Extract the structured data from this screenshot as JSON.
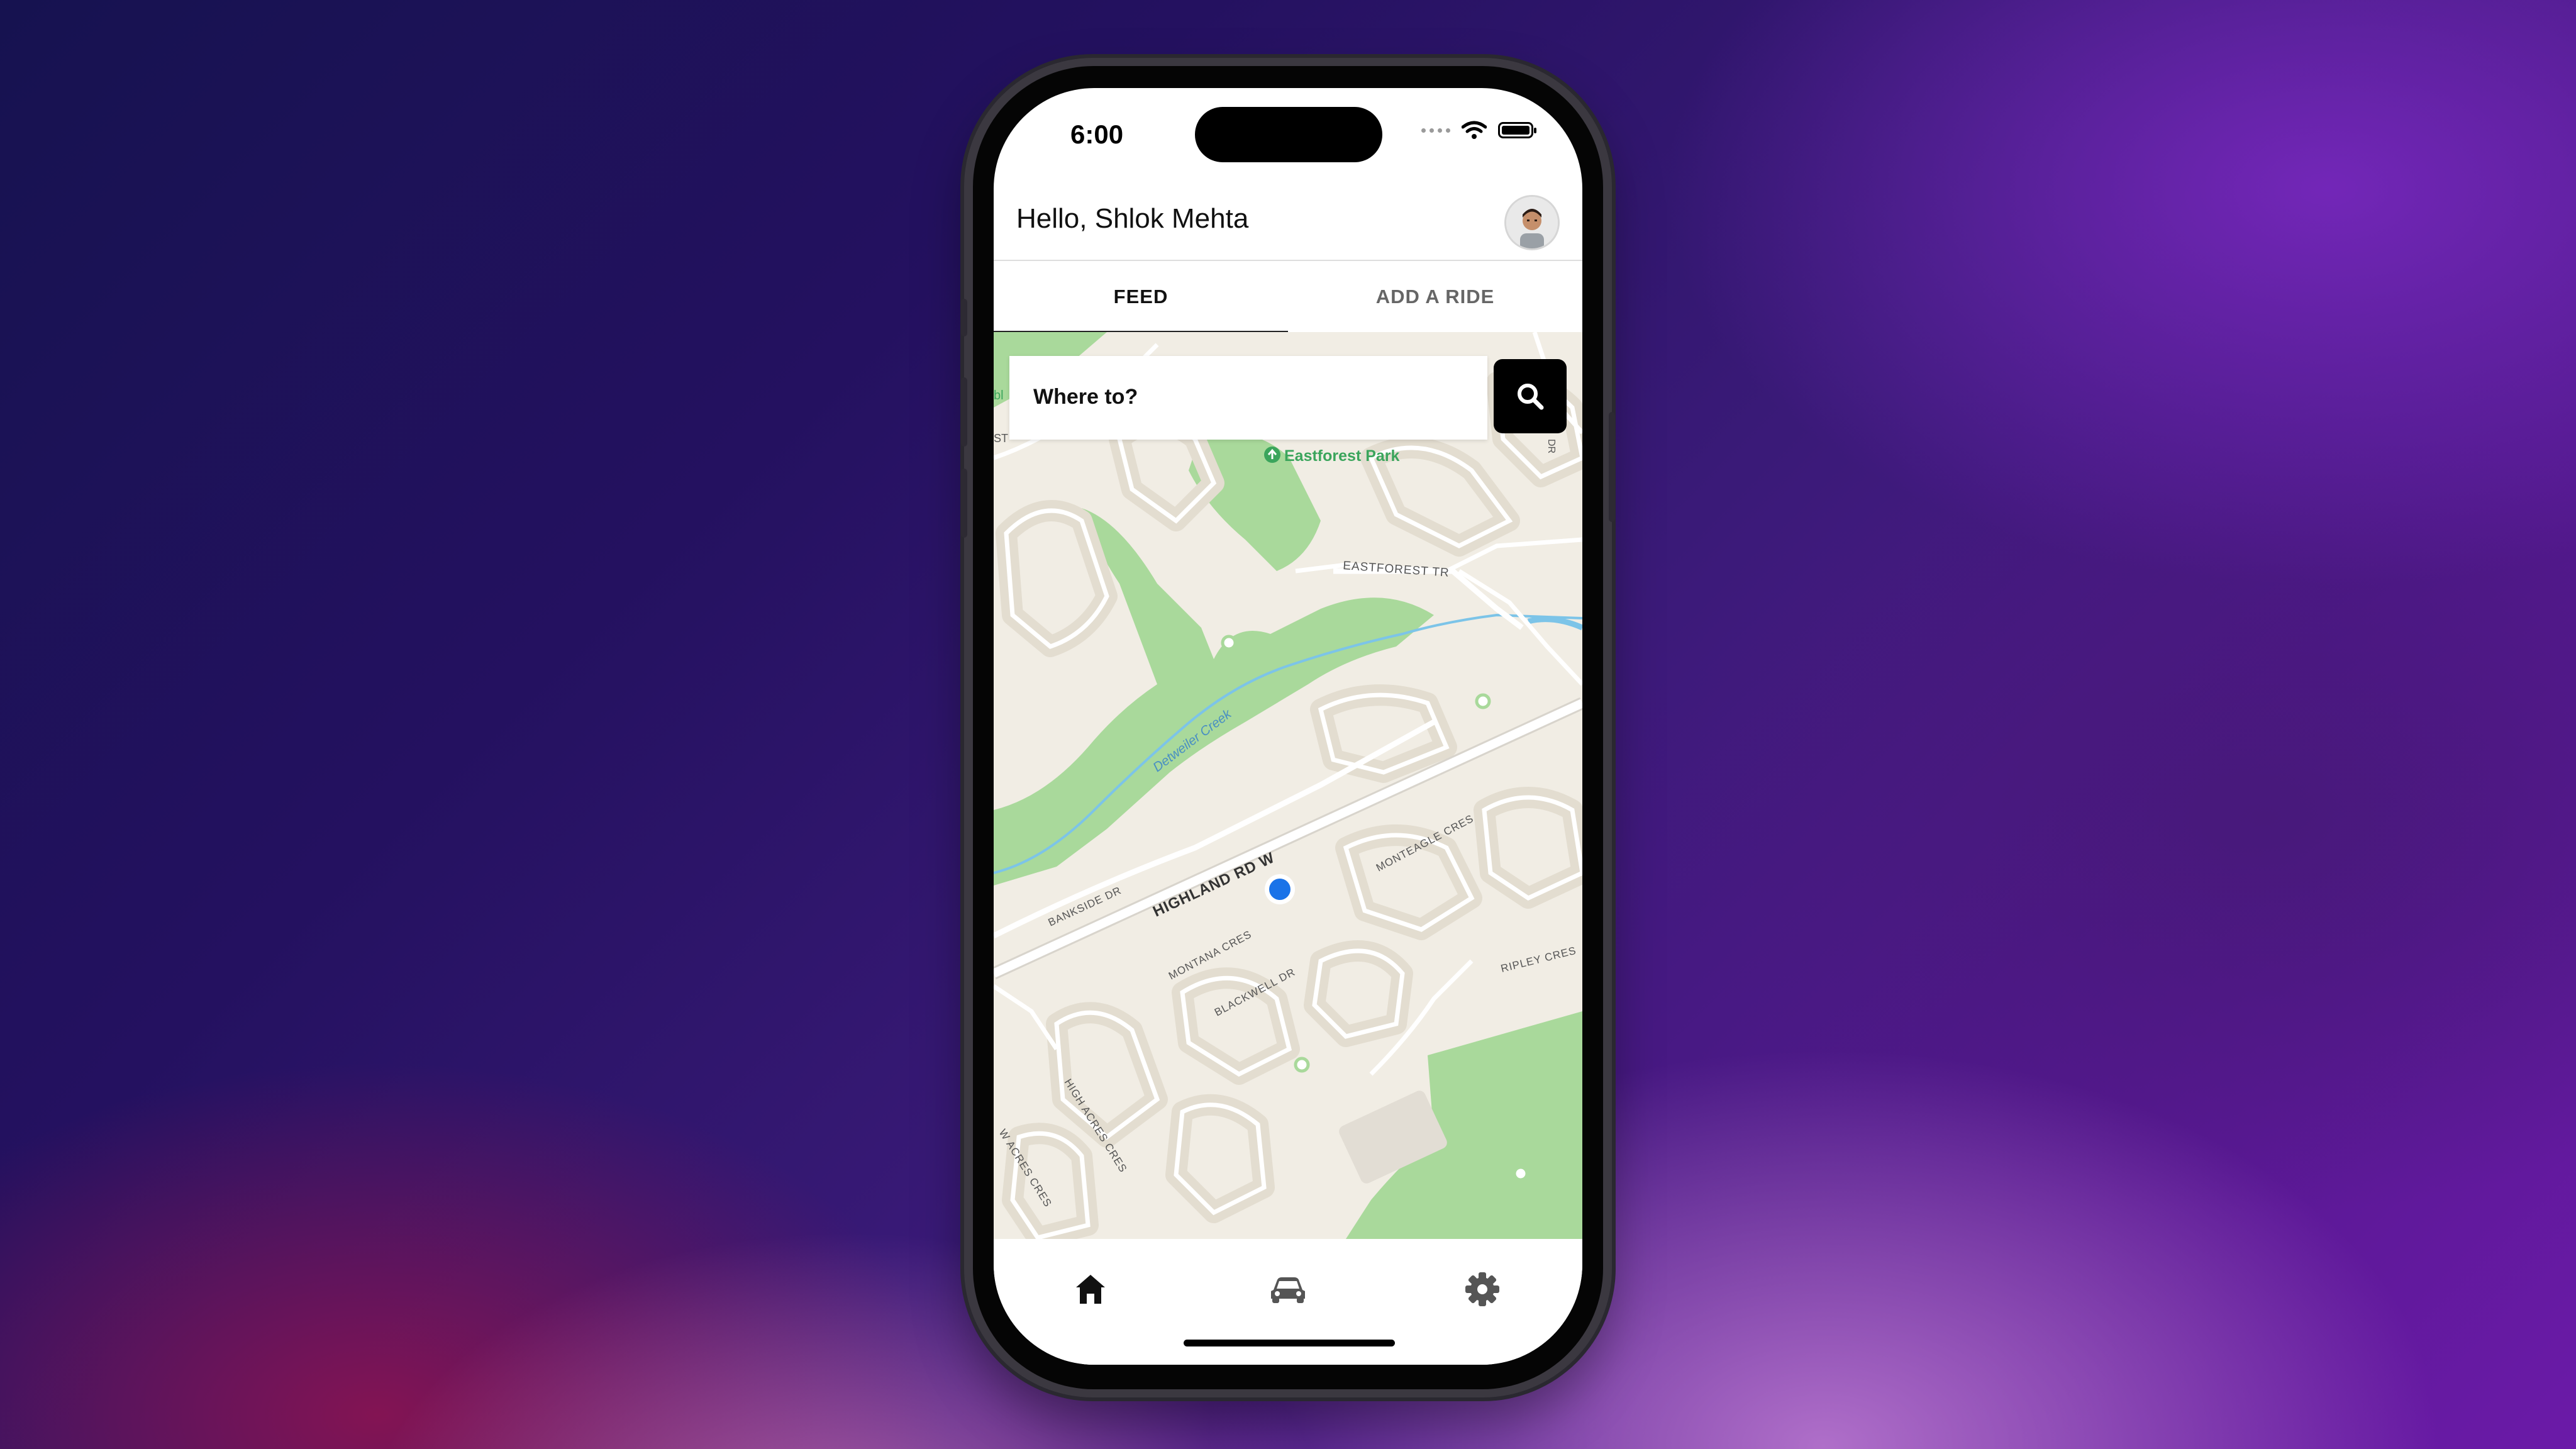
{
  "status_bar": {
    "time": "6:00"
  },
  "header": {
    "greeting": "Hello, Shlok Mehta"
  },
  "tabs": [
    {
      "label": "FEED",
      "active": true
    },
    {
      "label": "ADD A RIDE",
      "active": false
    }
  ],
  "search": {
    "placeholder": "Where to?"
  },
  "map": {
    "labels": {
      "park": "Eastforest Park",
      "eastforest_tr": "EASTFOREST TR",
      "creek": "Detweiler Creek",
      "highland": "HIGHLAND RD W",
      "bankside": "BANKSIDE DR",
      "monteagle": "MONTEAGLE CRES",
      "montana": "MONTANA CRES",
      "blackwell": "BLACKWELL DR",
      "ripley": "RIPLEY CRES",
      "high_acres": "HIGH ACRES CRES",
      "w_acres": "W ACRES CRES",
      "dr_edge": "DR",
      "st_edge": "ST",
      "bl_edge": "bl"
    }
  },
  "bottom_nav": [
    {
      "icon": "home-icon",
      "active": true
    },
    {
      "icon": "car-icon",
      "active": false
    },
    {
      "icon": "gear-icon",
      "active": false
    }
  ],
  "colors": {
    "accent": "#000000",
    "user_location": "#1a73e8",
    "park_green": "#a9d99b",
    "map_background": "#f1ede4"
  }
}
